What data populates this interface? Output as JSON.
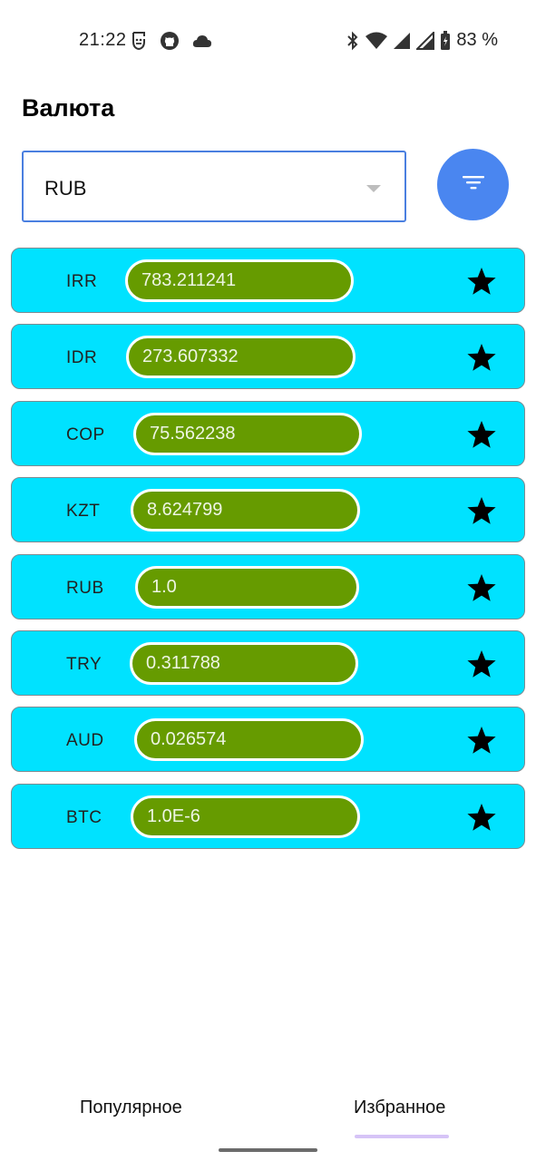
{
  "status_bar": {
    "time": "21:22",
    "battery": "83 %",
    "left_icons": [
      "face-icon",
      "github-icon",
      "cloud-icon"
    ],
    "right_icons": [
      "bluetooth-icon",
      "wifi-icon",
      "signal-icon",
      "signal-icon",
      "battery-icon"
    ]
  },
  "header": {
    "title": "Валюта"
  },
  "currency_select": {
    "value": "RUB"
  },
  "filter_button": {
    "icon": "filter-icon",
    "color": "#4a86f0"
  },
  "rates": [
    {
      "code": "IRR",
      "value": "783.211241"
    },
    {
      "code": "IDR",
      "value": "273.607332"
    },
    {
      "code": "COP",
      "value": "75.562238"
    },
    {
      "code": "KZT",
      "value": "8.624799"
    },
    {
      "code": "RUB",
      "value": "1.0"
    },
    {
      "code": "TRY",
      "value": "0.311788"
    },
    {
      "code": "AUD",
      "value": "0.026574"
    },
    {
      "code": "BTC",
      "value": "1.0E-6"
    }
  ],
  "bottom_nav": {
    "tabs": [
      {
        "label": "Популярное",
        "selected": false
      },
      {
        "label": "Избранное",
        "selected": true
      }
    ]
  },
  "colors": {
    "row_background": "#00e2ff",
    "value_pill": "#669b00",
    "select_border": "#4a7fe0",
    "tab_indicator": "#d6c4f7"
  }
}
